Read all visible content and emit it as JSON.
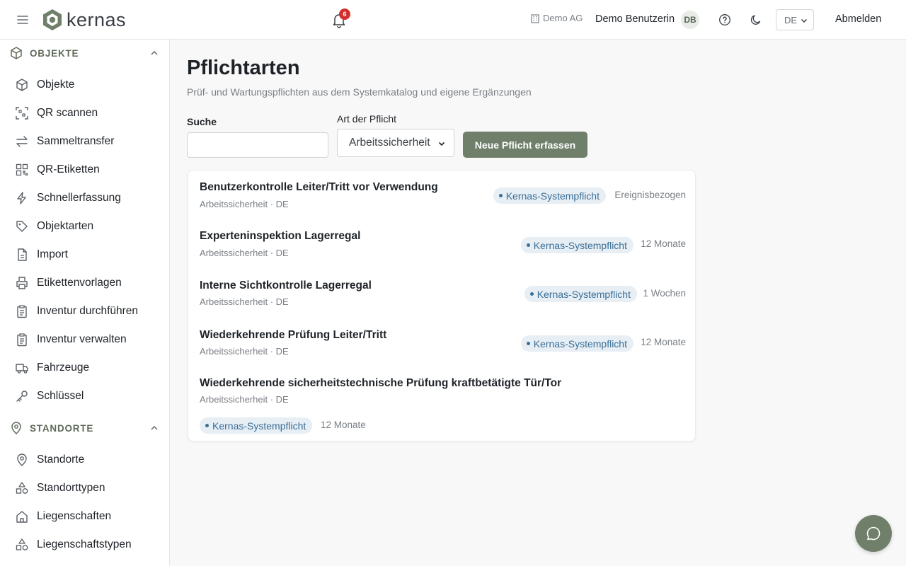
{
  "header": {
    "logo_text": "kernas",
    "notification_count": "6",
    "company": "Demo AG",
    "user_name": "Demo Benutzerin",
    "user_initials": "DB",
    "language": "DE",
    "logout_label": "Abmelden"
  },
  "sidebar": {
    "section_objekte": "OBJEKTE",
    "items_objekte": [
      {
        "label": "Objekte",
        "icon": "cube-icon"
      },
      {
        "label": "QR scannen",
        "icon": "qr-scan-icon"
      },
      {
        "label": "Sammeltransfer",
        "icon": "transfer-arrows-icon"
      },
      {
        "label": "QR-Etiketten",
        "icon": "qr-code-icon"
      },
      {
        "label": "Schnellerfassung",
        "icon": "lightning-icon"
      },
      {
        "label": "Objektarten",
        "icon": "tag-icon"
      },
      {
        "label": "Import",
        "icon": "file-icon"
      },
      {
        "label": "Etikettenvorlagen",
        "icon": "printer-icon"
      },
      {
        "label": "Inventur durchführen",
        "icon": "clipboard-icon"
      },
      {
        "label": "Inventur verwalten",
        "icon": "clipboard-list-icon"
      },
      {
        "label": "Fahrzeuge",
        "icon": "truck-icon"
      },
      {
        "label": "Schlüssel",
        "icon": "key-icon"
      }
    ],
    "section_standorte": "STANDORTE",
    "items_standorte": [
      {
        "label": "Standorte",
        "icon": "map-pin-icon"
      },
      {
        "label": "Standorttypen",
        "icon": "shapes-icon"
      },
      {
        "label": "Liegenschaften",
        "icon": "home-icon"
      },
      {
        "label": "Liegenschaftstypen",
        "icon": "shapes-icon"
      }
    ]
  },
  "main": {
    "title": "Pflichtarten",
    "subtitle": "Prüf- und Wartungspflichten aus dem Systemkatalog und eigene Ergänzungen",
    "search_label": "Suche",
    "search_value": "",
    "type_label": "Art der Pflicht",
    "type_selected": "Arbeitssicherheit",
    "new_button": "Neue Pflicht erfassen",
    "rows": [
      {
        "title": "Benutzerkontrolle Leiter/Tritt vor Verwendung",
        "meta": "Arbeitssicherheit · DE",
        "badge": "Kernas-Systempflicht",
        "interval": "Ereignisbezogen"
      },
      {
        "title": "Experteninspektion Lagerregal",
        "meta": "Arbeitssicherheit · DE",
        "badge": "Kernas-Systempflicht",
        "interval": "12 Monate"
      },
      {
        "title": "Interne Sichtkontrolle Lagerregal",
        "meta": "Arbeitssicherheit · DE",
        "badge": "Kernas-Systempflicht",
        "interval": "1 Wochen"
      },
      {
        "title": "Wiederkehrende Prüfung Leiter/Tritt",
        "meta": "Arbeitssicherheit · DE",
        "badge": "Kernas-Systempflicht",
        "interval": "12 Monate"
      },
      {
        "title": "Wiederkehrende sicherheitstechnische Prüfung kraftbetätigte Tür/Tor",
        "meta": "Arbeitssicherheit · DE",
        "badge": "Kernas-Systempflicht",
        "interval": "12 Monate"
      }
    ]
  },
  "colors": {
    "accent": "#6f7f6a",
    "badge_bg": "#e7eef4",
    "badge_text": "#3a6f98",
    "notification": "#d32f2f"
  }
}
